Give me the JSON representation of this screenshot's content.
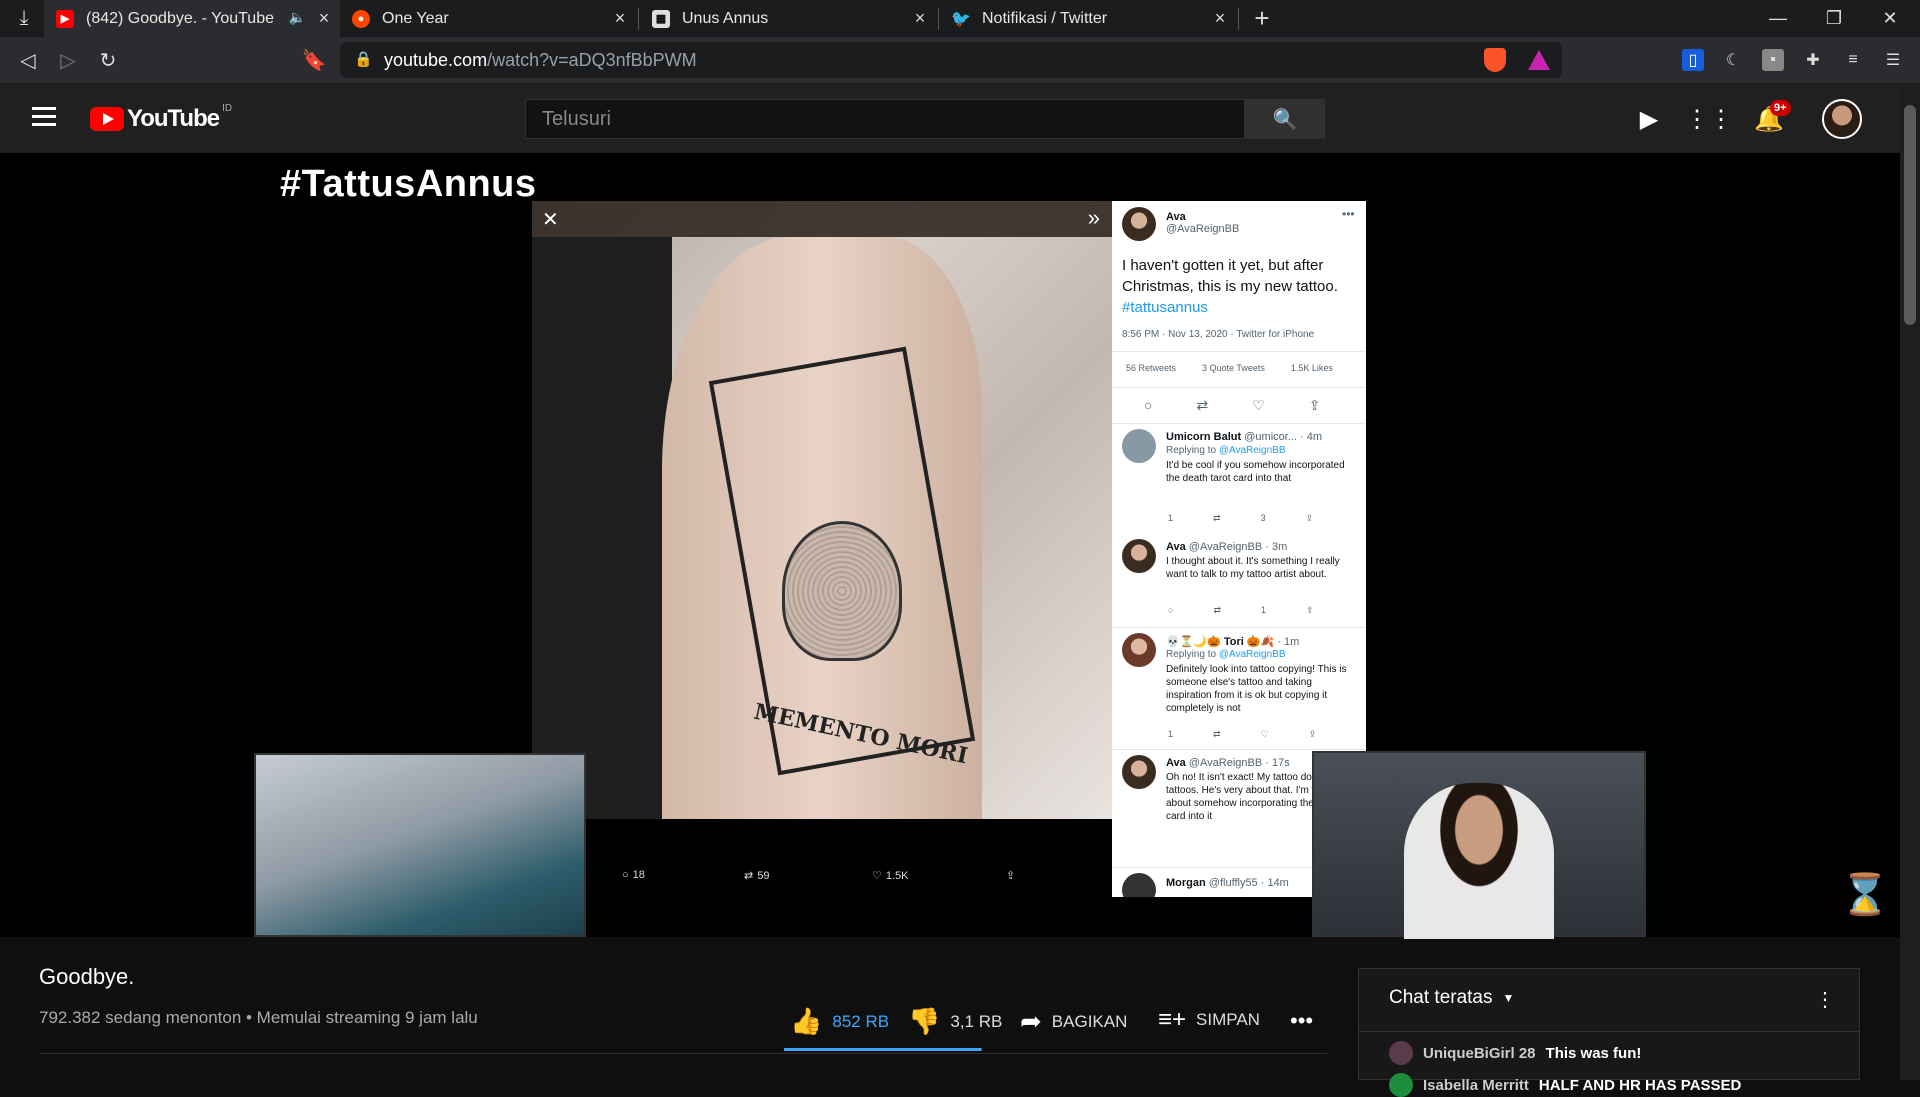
{
  "browser": {
    "tabs": [
      {
        "title": "(842) Goodbye. - YouTube",
        "active": true
      },
      {
        "title": "One Year",
        "active": false
      },
      {
        "title": "Unus Annus",
        "active": false
      },
      {
        "title": "Notifikasi / Twitter",
        "active": false
      }
    ],
    "new_tab": "+",
    "url_host": "youtube.com",
    "url_path": "/watch?v=aDQ3nfBbPWM"
  },
  "youtube": {
    "logo_word": "YouTube",
    "region": "ID",
    "search_placeholder": "Telusuri",
    "notification_count": "9+"
  },
  "player": {
    "overlay_title": "#TattusAnnus",
    "photo_banner": "MEMENTO MORI",
    "photo_footer": {
      "replies": "18",
      "retweets": "59",
      "likes": "1.5K"
    },
    "tweet": {
      "author": "Ava",
      "handle": "@AvaReignBB",
      "text": "I haven't gotten it yet, but after Christmas, this is my new tattoo.",
      "hashtag": "#tattusannus",
      "meta": "8:56 PM · Nov 13, 2020 · Twitter for iPhone",
      "retweets_label": "56 Retweets",
      "quotes_label": "3 Quote Tweets",
      "likes_label": "1.5K Likes"
    },
    "replies": [
      {
        "name": "Umicorn Balut",
        "handle": "@umicor... · 4m",
        "replying": "Replying to",
        "to": "@AvaReignBB",
        "text": "It'd be cool if you somehow incorporated the death tarot card into that",
        "c": "1",
        "l": "3"
      },
      {
        "name": "Ava",
        "handle": "@AvaReignBB · 3m",
        "text": "I thought about it. It's something I really want to talk to my tattoo artist about.",
        "l": "1"
      },
      {
        "name": "💀⏳🌙🎃 Tori 🎃🍂",
        "handle": "· 1m",
        "replying": "Replying to",
        "to": "@AvaReignBB",
        "text": "Definitely look into tattoo copying! This is someone else's tattoo and taking inspiration from it is ok but copying it completely is not",
        "c": "1"
      },
      {
        "name": "Ava",
        "handle": "@AvaReignBB · 17s",
        "text": "Oh no! It isn't exact! My tattoo doesn't copy tattoos. He's very about that. I'm thinking about somehow incorporating the d tarot card into it"
      },
      {
        "name": "Morgan",
        "handle": "@fluffly55 · 14m"
      }
    ]
  },
  "video": {
    "title": "Goodbye.",
    "meta": "792.382 sedang menonton • Memulai streaming 9 jam lalu",
    "like_count": "852 RB",
    "dislike_count": "3,1 RB",
    "share_label": "BAGIKAN",
    "save_label": "SIMPAN",
    "like_ratio": 0.996
  },
  "chat": {
    "title": "Chat teratas",
    "messages": [
      {
        "author": "UniqueBiGirl 28",
        "text": "This was fun!"
      },
      {
        "author": "Isabella Merritt",
        "text": "HALF AND HR HAS PASSED"
      }
    ]
  }
}
